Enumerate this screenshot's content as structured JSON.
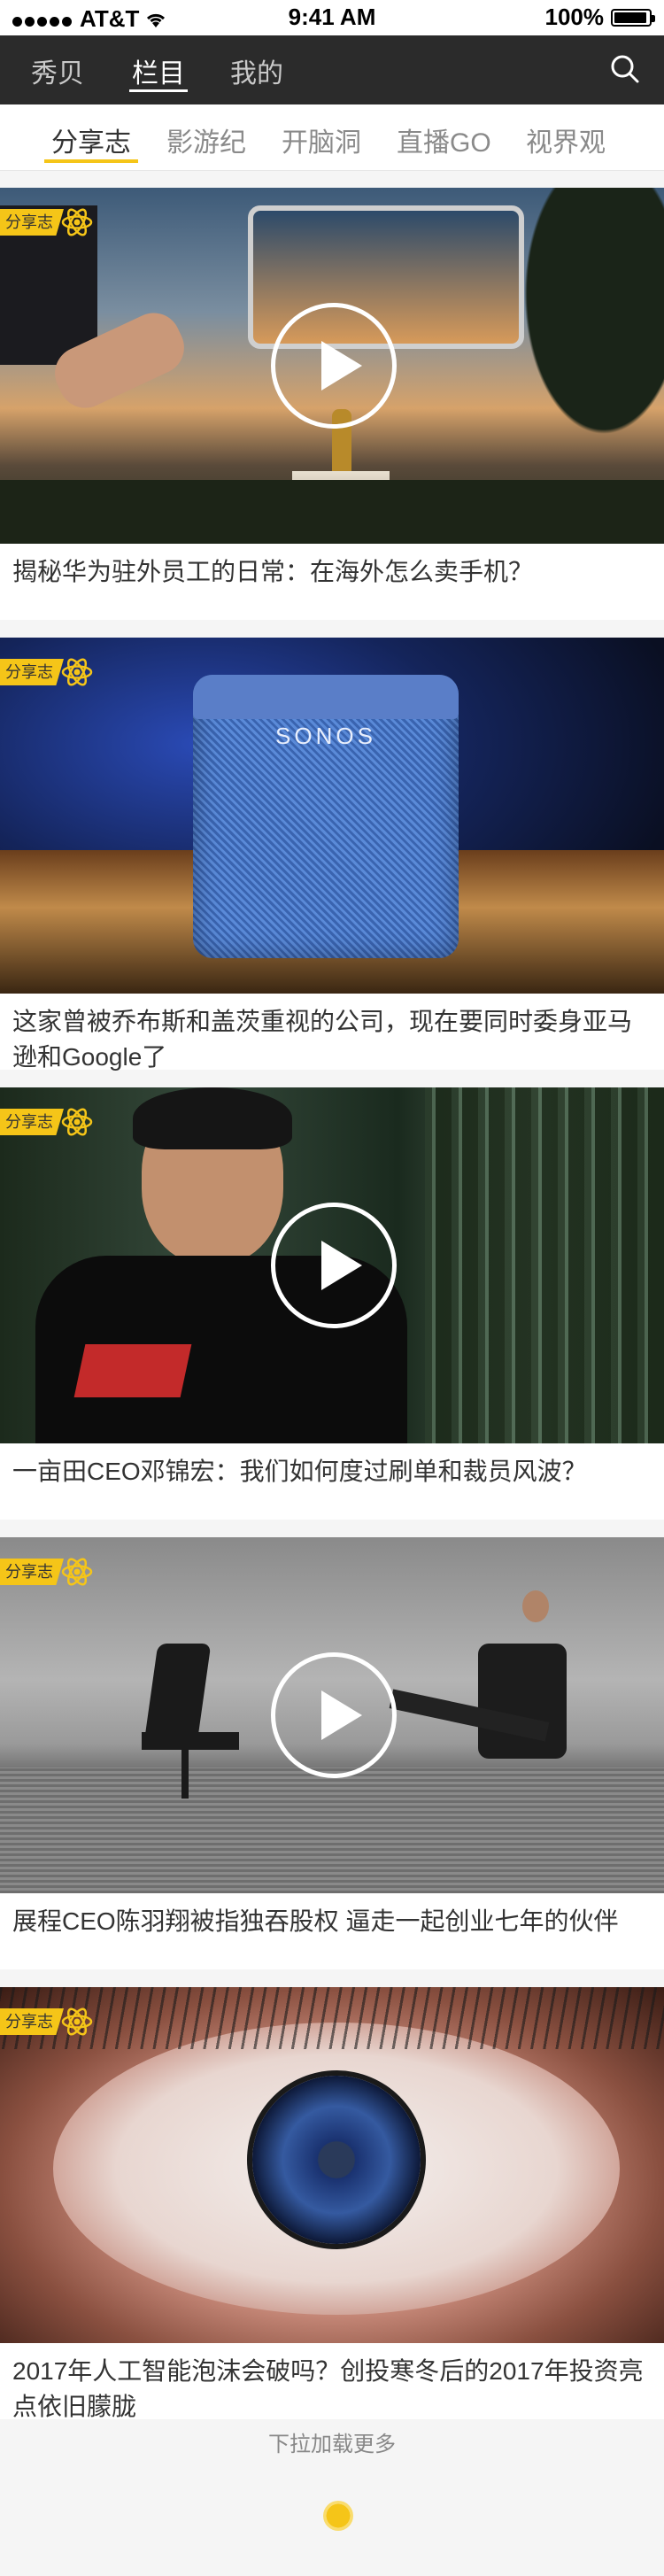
{
  "status_bar": {
    "carrier": "AT&T",
    "time": "9:41 AM",
    "battery": "100%"
  },
  "nav": {
    "items": [
      {
        "label": "秀贝"
      },
      {
        "label": "栏目"
      },
      {
        "label": "我的"
      }
    ],
    "active_index": 1
  },
  "tabs": {
    "items": [
      {
        "label": "分享志"
      },
      {
        "label": "影游纪"
      },
      {
        "label": "开脑洞"
      },
      {
        "label": "直播GO"
      },
      {
        "label": "视界观"
      }
    ],
    "active_index": 0
  },
  "articles": [
    {
      "badge": "分享志",
      "title": "揭秘华为驻外员工的日常：在海外怎么卖手机？",
      "has_video": true
    },
    {
      "badge": "分享志",
      "title": "这家曾被乔布斯和盖茨重视的公司，现在要同时委身亚马逊和Google了",
      "has_video": false,
      "image_text": "SONOS"
    },
    {
      "badge": "分享志",
      "title": "一亩田CEO邓锦宏：我们如何度过刷单和裁员风波？",
      "has_video": true
    },
    {
      "badge": "分享志",
      "title": "展程CEO陈羽翔被指独吞股权 逼走一起创业七年的伙伴",
      "has_video": true
    },
    {
      "badge": "分享志",
      "title": "2017年人工智能泡沫会破吗？创投寒冬后的2017年投资亮点依旧朦胧",
      "has_video": false
    }
  ],
  "footer": {
    "load_more": "下拉加载更多"
  },
  "colors": {
    "accent": "#f5c518",
    "nav_bg": "#2b2b2b"
  }
}
